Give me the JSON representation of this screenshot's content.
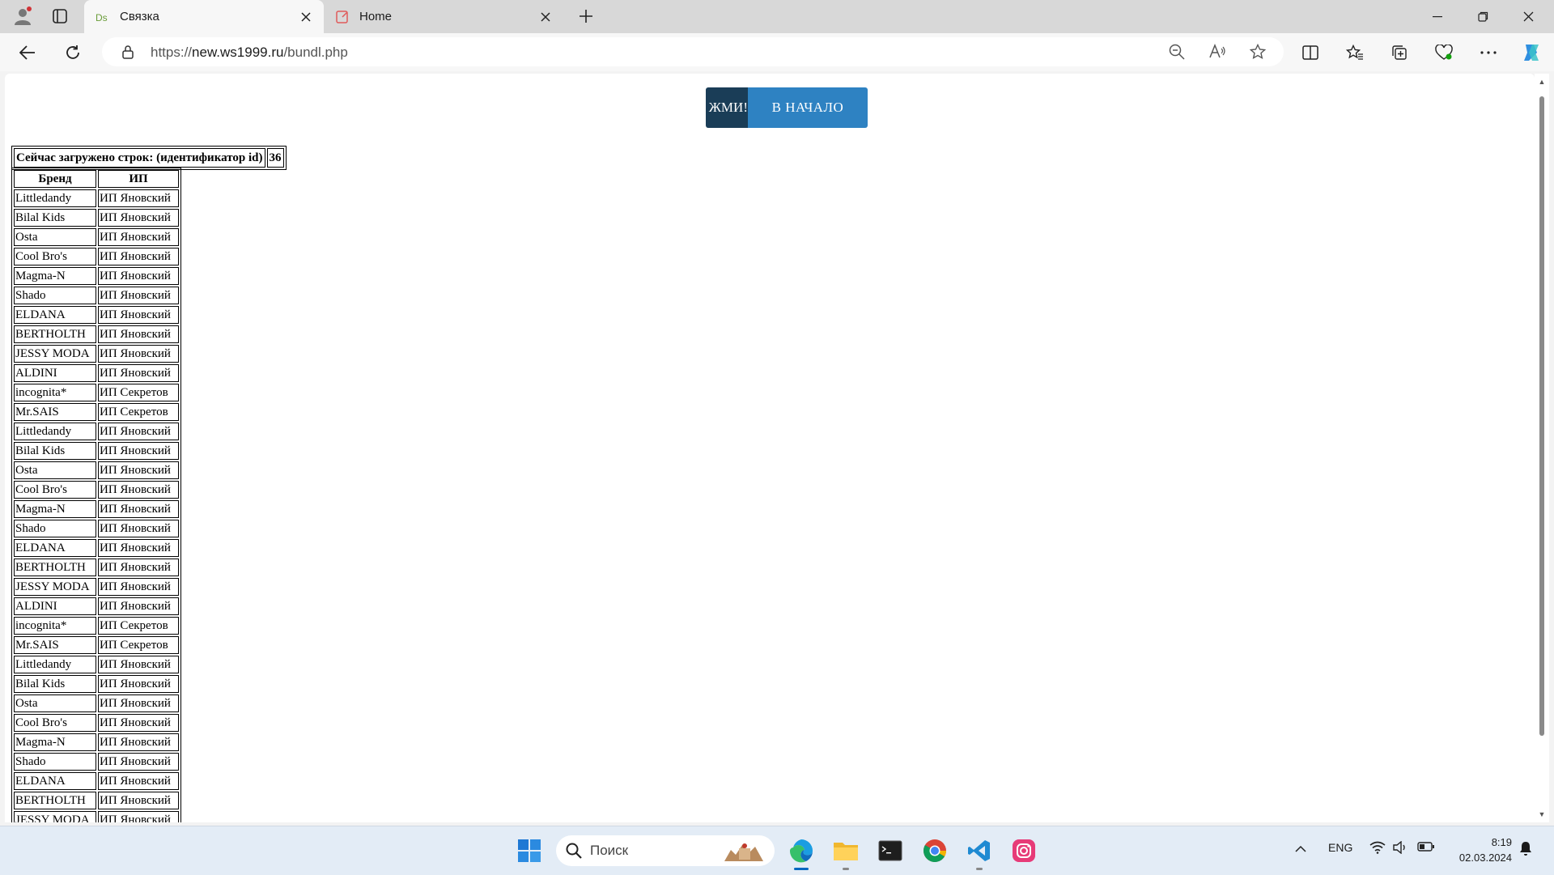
{
  "browser": {
    "tabs": [
      {
        "title": "Связка",
        "active": true
      },
      {
        "title": "Home",
        "active": false
      }
    ],
    "url_scheme": "https://",
    "url_host": "new.ws1999.ru",
    "url_path": "/bundl.php"
  },
  "page": {
    "buttons": {
      "press_label": "ЖМИ!",
      "home_label": "В НАЧАЛО"
    },
    "loaded_rows_label": "Сейчас загружено строк: (идентификатор id)",
    "loaded_rows_count": "36",
    "table": {
      "headers": [
        "Бренд",
        "ИП"
      ],
      "rows": [
        [
          "Littledandy",
          "ИП Яновский"
        ],
        [
          "Bilal Kids",
          "ИП Яновский"
        ],
        [
          "Osta",
          "ИП Яновский"
        ],
        [
          "Cool Bro's",
          "ИП Яновский"
        ],
        [
          "Magma-N",
          "ИП Яновский"
        ],
        [
          "Shado",
          "ИП Яновский"
        ],
        [
          "ELDANA",
          "ИП Яновский"
        ],
        [
          "BERTHOLTH",
          "ИП Яновский"
        ],
        [
          "JESSY MODA",
          "ИП Яновский"
        ],
        [
          "ALDINI",
          "ИП Яновский"
        ],
        [
          "incognita*",
          "ИП Секретов"
        ],
        [
          "Mr.SAIS",
          "ИП Секретов"
        ],
        [
          "Littledandy",
          "ИП Яновский"
        ],
        [
          "Bilal Kids",
          "ИП Яновский"
        ],
        [
          "Osta",
          "ИП Яновский"
        ],
        [
          "Cool Bro's",
          "ИП Яновский"
        ],
        [
          "Magma-N",
          "ИП Яновский"
        ],
        [
          "Shado",
          "ИП Яновский"
        ],
        [
          "ELDANA",
          "ИП Яновский"
        ],
        [
          "BERTHOLTH",
          "ИП Яновский"
        ],
        [
          "JESSY MODA",
          "ИП Яновский"
        ],
        [
          "ALDINI",
          "ИП Яновский"
        ],
        [
          "incognita*",
          "ИП Секретов"
        ],
        [
          "Mr.SAIS",
          "ИП Секретов"
        ],
        [
          "Littledandy",
          "ИП Яновский"
        ],
        [
          "Bilal Kids",
          "ИП Яновский"
        ],
        [
          "Osta",
          "ИП Яновский"
        ],
        [
          "Cool Bro's",
          "ИП Яновский"
        ],
        [
          "Magma-N",
          "ИП Яновский"
        ],
        [
          "Shado",
          "ИП Яновский"
        ],
        [
          "ELDANA",
          "ИП Яновский"
        ],
        [
          "BERTHOLTH",
          "ИП Яновский"
        ],
        [
          "JESSY MODA",
          "ИП Яновский"
        ]
      ]
    }
  },
  "taskbar": {
    "search_placeholder": "Поиск",
    "language": "ENG",
    "time": "8:19",
    "date": "02.03.2024",
    "apps": [
      "start-icon",
      "edge-icon",
      "file-explorer-icon",
      "terminal-icon",
      "chrome-icon",
      "vscode-icon",
      "instagram-icon"
    ]
  },
  "colors": {
    "press_button": "#1a3d57",
    "home_button": "#2e82c2",
    "accent": "#0067c0"
  }
}
